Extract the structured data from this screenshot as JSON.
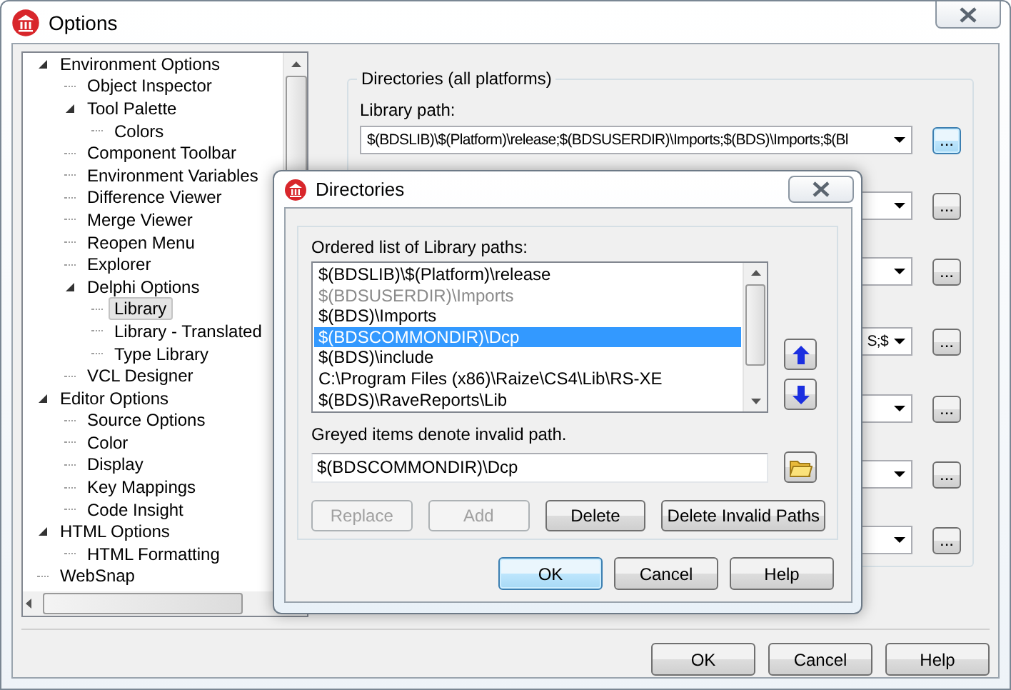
{
  "window": {
    "title": "Options"
  },
  "tree": [
    {
      "label": "Environment Options",
      "expanded": true,
      "selected": false,
      "children": [
        {
          "label": "Object Inspector",
          "selected": false
        },
        {
          "label": "Tool Palette",
          "expanded": true,
          "selected": false,
          "children": [
            {
              "label": "Colors",
              "selected": false
            }
          ]
        },
        {
          "label": "Component Toolbar",
          "selected": false
        },
        {
          "label": "Environment Variables",
          "selected": false
        },
        {
          "label": "Difference Viewer",
          "selected": false
        },
        {
          "label": "Merge Viewer",
          "selected": false
        },
        {
          "label": "Reopen Menu",
          "selected": false
        },
        {
          "label": "Explorer",
          "selected": false
        },
        {
          "label": "Delphi Options",
          "expanded": true,
          "selected": false,
          "children": [
            {
              "label": "Library",
              "selected": true
            },
            {
              "label": "Library - Translated",
              "selected": false
            },
            {
              "label": "Type Library",
              "selected": false
            }
          ]
        },
        {
          "label": "VCL Designer",
          "selected": false
        }
      ]
    },
    {
      "label": "Editor Options",
      "expanded": true,
      "selected": false,
      "children": [
        {
          "label": "Source Options",
          "selected": false
        },
        {
          "label": "Color",
          "selected": false
        },
        {
          "label": "Display",
          "selected": false
        },
        {
          "label": "Key Mappings",
          "selected": false
        },
        {
          "label": "Code Insight",
          "selected": false
        }
      ]
    },
    {
      "label": "HTML Options",
      "expanded": true,
      "selected": false,
      "children": [
        {
          "label": "HTML Formatting",
          "selected": false
        }
      ]
    },
    {
      "label": "WebSnap",
      "selected": false
    }
  ],
  "directories_group": {
    "title": "Directories (all platforms)",
    "library_path": {
      "label": "Library path:",
      "value": "$(BDSLIB)\\$(Platform)\\release;$(BDSUSERDIR)\\Imports;$(BDS)\\Imports;$(Bl",
      "button": "...",
      "focused": true
    },
    "path_combos": [
      {
        "button": "..."
      },
      {
        "button": "..."
      },
      {
        "value": "S;$",
        "button": "..."
      },
      {
        "button": "..."
      },
      {
        "button": "..."
      },
      {
        "button": "..."
      }
    ]
  },
  "buttons": [
    {
      "label": "OK"
    },
    {
      "label": "Cancel"
    },
    {
      "label": "Help"
    }
  ],
  "dialog": {
    "title": "Directories",
    "list_label": "Ordered list of Library paths:",
    "paths": [
      {
        "text": "$(BDSLIB)\\$(Platform)\\release",
        "invalid": false,
        "selected": false
      },
      {
        "text": "$(BDSUSERDIR)\\Imports",
        "invalid": true,
        "selected": false
      },
      {
        "text": "$(BDS)\\Imports",
        "invalid": false,
        "selected": false
      },
      {
        "text": "$(BDSCOMMONDIR)\\Dcp",
        "invalid": false,
        "selected": true
      },
      {
        "text": "$(BDS)\\include",
        "invalid": false,
        "selected": false
      },
      {
        "text": "C:\\Program Files (x86)\\Raize\\CS4\\Lib\\RS-XE",
        "invalid": false,
        "selected": false
      },
      {
        "text": "$(BDS)\\RaveReports\\Lib",
        "invalid": false,
        "selected": false
      }
    ],
    "note": "Greyed items denote invalid path.",
    "path_value": "$(BDSCOMMONDIR)\\Dcp",
    "actions": [
      {
        "label": "Replace",
        "disabled": true
      },
      {
        "label": "Add",
        "disabled": true
      },
      {
        "label": "Delete",
        "disabled": false
      },
      {
        "label": "Delete Invalid Paths",
        "disabled": false
      }
    ],
    "buttons": [
      {
        "label": "OK",
        "default": true
      },
      {
        "label": "Cancel",
        "default": false
      },
      {
        "label": "Help",
        "default": false
      }
    ]
  }
}
